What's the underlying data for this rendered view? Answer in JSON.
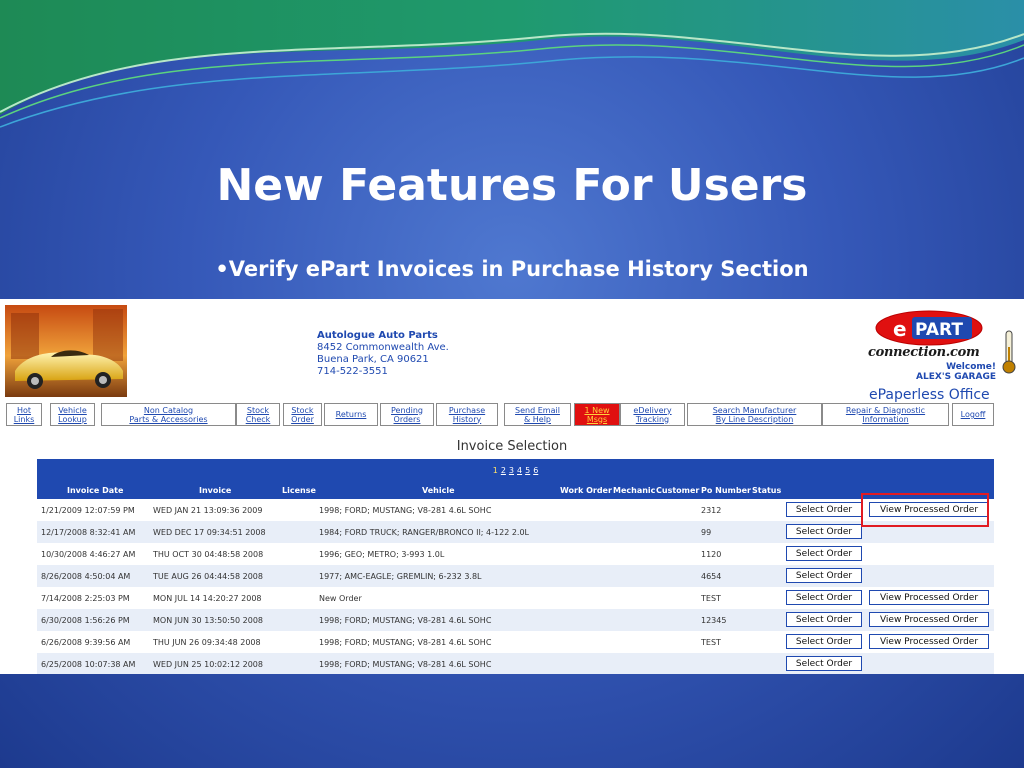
{
  "slide": {
    "title": "New Features For Users",
    "bullet": "•Verify ePart Invoices in Purchase History Section"
  },
  "shop": {
    "name": "Autologue Auto Parts",
    "address": "8452 Commonwealth Ave.",
    "city": "Buena Park, CA 90621",
    "phone": "714-522-3551"
  },
  "logo": {
    "wordmark": "ePART",
    "domain": "connection.com",
    "welcome": "Welcome!",
    "garage": "ALEX'S GARAGE",
    "office": "ePaperless Office"
  },
  "nav": [
    {
      "label": "Hot\nLinks"
    },
    {
      "label": "Vehicle\nLookup"
    },
    {
      "label": "Non Catalog\nParts & Accessories"
    },
    {
      "label": "Stock\nCheck"
    },
    {
      "label": "Stock\nOrder"
    },
    {
      "label": "Returns"
    },
    {
      "label": "Pending\nOrders"
    },
    {
      "label": "Purchase\nHistory"
    },
    {
      "label": "Send Email\n& Help"
    },
    {
      "label": "1 New\nMsgs"
    },
    {
      "label": "eDelivery\nTracking"
    },
    {
      "label": "Search Manufacturer\nBy Line Description"
    },
    {
      "label": "Repair & Diagnostic\nInformation"
    },
    {
      "label": "Logoff"
    }
  ],
  "invoice": {
    "title": "Invoice Selection",
    "pages": [
      "1",
      "2",
      "3",
      "4",
      "5",
      "6"
    ],
    "columns": [
      "Invoice Date",
      "Invoice",
      "License",
      "Vehicle",
      "Work Order",
      "Mechanic",
      "Customer",
      "Po Number",
      "Status"
    ],
    "select_label": "Select Order",
    "view_label": "View Processed Order",
    "rows": [
      {
        "date": "1/21/2009 12:07:59 PM",
        "invoice": "WED JAN 21 13:09:36 2009",
        "vehicle": "1998; FORD; MUSTANG; V8-281 4.6L SOHC",
        "po": "2312",
        "view": true
      },
      {
        "date": "12/17/2008 8:32:41 AM",
        "invoice": "WED DEC 17 09:34:51 2008",
        "vehicle": "1984; FORD TRUCK; RANGER/BRONCO II; 4-122 2.0L",
        "po": "99",
        "view": false
      },
      {
        "date": "10/30/2008 4:46:27 AM",
        "invoice": "THU OCT 30 04:48:58 2008",
        "vehicle": "1996; GEO; METRO; 3-993 1.0L",
        "po": "1120",
        "view": false
      },
      {
        "date": "8/26/2008 4:50:04 AM",
        "invoice": "TUE AUG 26 04:44:58 2008",
        "vehicle": "1977; AMC-EAGLE; GREMLIN; 6-232 3.8L",
        "po": "4654",
        "view": false
      },
      {
        "date": "7/14/2008 2:25:03 PM",
        "invoice": "MON JUL 14 14:20:27 2008",
        "vehicle": "New Order",
        "po": "TEST",
        "view": true
      },
      {
        "date": "6/30/2008 1:56:26 PM",
        "invoice": "MON JUN 30 13:50:50 2008",
        "vehicle": "1998; FORD; MUSTANG; V8-281 4.6L SOHC",
        "po": "12345",
        "view": true
      },
      {
        "date": "6/26/2008 9:39:56 AM",
        "invoice": "THU JUN 26 09:34:48 2008",
        "vehicle": "1998; FORD; MUSTANG; V8-281 4.6L SOHC",
        "po": "TEST",
        "view": true
      },
      {
        "date": "6/25/2008 10:07:38 AM",
        "invoice": "WED JUN 25 10:02:12 2008",
        "vehicle": "1998; FORD; MUSTANG; V8-281 4.6L SOHC",
        "po": "",
        "view": false
      }
    ]
  },
  "colors": {
    "brand_blue": "#1f49b0",
    "alert_red": "#e01010",
    "highlight_red": "#e11b22"
  }
}
